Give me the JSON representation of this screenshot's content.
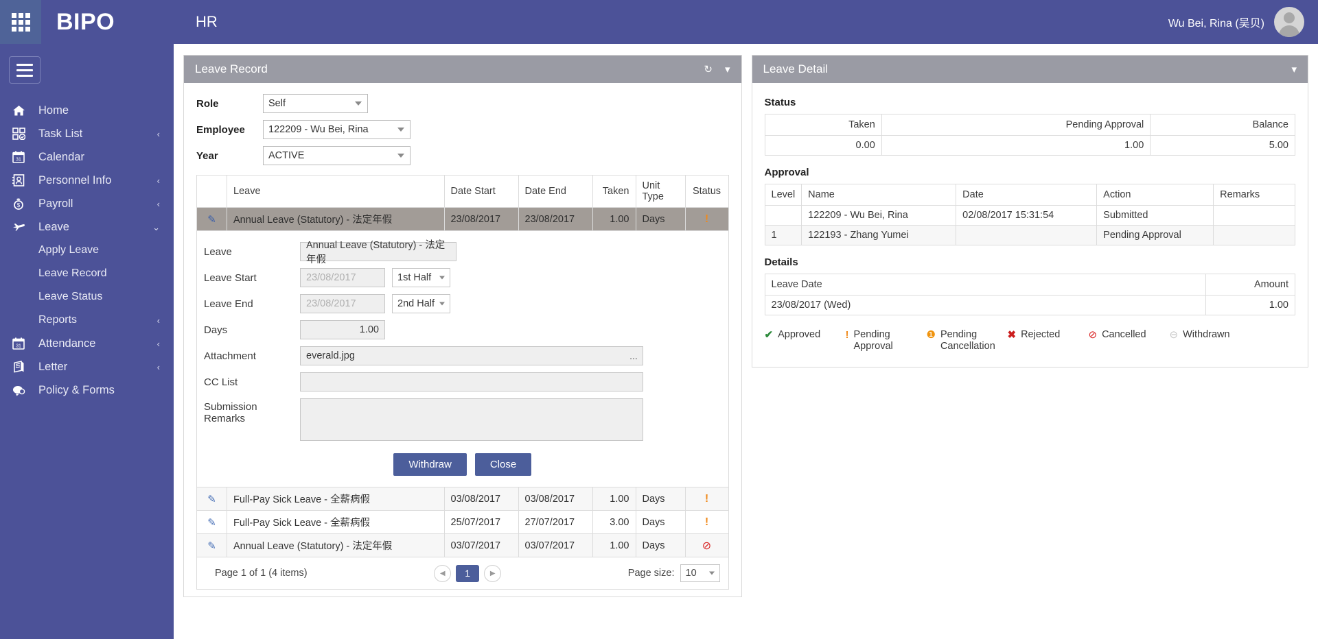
{
  "topbar": {
    "brand": "BIPO",
    "module": "HR",
    "user_name": "Wu Bei, Rina (吴贝)",
    "launcher_icon": "grid-apps-icon",
    "avatar_icon": "user-avatar-icon"
  },
  "sidebar": {
    "toggle_icon": "hamburger-icon",
    "items": [
      {
        "label": "Home",
        "icon": "home-icon",
        "caret": ""
      },
      {
        "label": "Task List",
        "icon": "task-list-icon",
        "caret": "‹"
      },
      {
        "label": "Calendar",
        "icon": "calendar-icon",
        "caret": ""
      },
      {
        "label": "Personnel Info",
        "icon": "personnel-icon",
        "caret": "‹"
      },
      {
        "label": "Payroll",
        "icon": "payroll-icon",
        "caret": "‹"
      },
      {
        "label": "Leave",
        "icon": "leave-plane-icon",
        "caret": "⌄"
      }
    ],
    "leave_subitems": [
      {
        "label": "Apply Leave",
        "caret": ""
      },
      {
        "label": "Leave Record",
        "caret": ""
      },
      {
        "label": "Leave Status",
        "caret": ""
      },
      {
        "label": "Reports",
        "caret": "‹"
      }
    ],
    "items_after": [
      {
        "label": "Attendance",
        "icon": "attendance-icon",
        "caret": "‹"
      },
      {
        "label": "Letter",
        "icon": "letter-icon",
        "caret": "‹"
      },
      {
        "label": "Policy & Forms",
        "icon": "policy-forms-icon",
        "caret": ""
      }
    ]
  },
  "leave_record": {
    "title": "Leave Record",
    "refresh_icon": "refresh-icon",
    "collapse_icon": "chevron-down-icon",
    "filters": {
      "role_label": "Role",
      "role_value": "Self",
      "employee_label": "Employee",
      "employee_value": "122209 - Wu Bei, Rina",
      "year_label": "Year",
      "year_value": "ACTIVE"
    },
    "columns": [
      "",
      "Leave",
      "Date Start",
      "Date End",
      "Taken",
      "Unit Type",
      "Status"
    ],
    "rows": [
      {
        "edit_icon": "pencil-icon",
        "leave": "Annual Leave (Statutory) - 法定年假",
        "date_start": "23/08/2017",
        "date_end": "23/08/2017",
        "taken": "1.00",
        "unit": "Days",
        "status_icon": "pending-approval-icon",
        "status_glyph": "!",
        "selected": true
      },
      {
        "edit_icon": "pencil-icon",
        "leave": "Full-Pay Sick Leave - 全薪病假",
        "date_start": "03/08/2017",
        "date_end": "03/08/2017",
        "taken": "1.00",
        "unit": "Days",
        "status_icon": "pending-approval-icon",
        "status_glyph": "!",
        "selected": false
      },
      {
        "edit_icon": "pencil-icon",
        "leave": "Full-Pay Sick Leave - 全薪病假",
        "date_start": "25/07/2017",
        "date_end": "27/07/2017",
        "taken": "3.00",
        "unit": "Days",
        "status_icon": "pending-approval-icon",
        "status_glyph": "!",
        "selected": false
      },
      {
        "edit_icon": "pencil-icon",
        "leave": "Annual Leave (Statutory) - 法定年假",
        "date_start": "03/07/2017",
        "date_end": "03/07/2017",
        "taken": "1.00",
        "unit": "Days",
        "status_icon": "cancelled-icon",
        "status_glyph": "⊘",
        "selected": false
      }
    ],
    "detail_form": {
      "leave_label": "Leave",
      "leave_value": "Annual Leave (Statutory) - 法定年假",
      "leave_start_label": "Leave Start",
      "leave_start_value": "23/08/2017",
      "leave_start_half": "1st Half",
      "leave_end_label": "Leave End",
      "leave_end_value": "23/08/2017",
      "leave_end_half": "2nd Half",
      "days_label": "Days",
      "days_value": "1.00",
      "attachment_label": "Attachment",
      "attachment_value": "everald.jpg",
      "browse_label": "...",
      "cc_list_label": "CC List",
      "cc_list_value": "",
      "remarks_label": "Submission Remarks",
      "remarks_value": "",
      "withdraw_button": "Withdraw",
      "close_button": "Close"
    },
    "pager": {
      "info": "Page 1 of 1 (4 items)",
      "prev_icon": "chevron-left-icon",
      "next_icon": "chevron-right-icon",
      "current_page": "1",
      "page_size_label": "Page size:",
      "page_size_value": "10"
    }
  },
  "leave_detail": {
    "title": "Leave Detail",
    "collapse_icon": "chevron-down-icon",
    "status_section_title": "Status",
    "status_columns": [
      "Taken",
      "Pending Approval",
      "Balance"
    ],
    "status_values": [
      "0.00",
      "1.00",
      "5.00"
    ],
    "approval_section_title": "Approval",
    "approval_columns": [
      "Level",
      "Name",
      "Date",
      "Action",
      "Remarks"
    ],
    "approval_rows": [
      {
        "level": "",
        "name": "122209 - Wu Bei, Rina",
        "date": "02/08/2017 15:31:54",
        "action": "Submitted",
        "remarks": ""
      },
      {
        "level": "1",
        "name": "122193 - Zhang Yumei",
        "date": "",
        "action": "Pending Approval",
        "remarks": ""
      }
    ],
    "details_section_title": "Details",
    "details_columns": [
      "Leave Date",
      "Amount"
    ],
    "details_rows": [
      {
        "leave_date": "23/08/2017 (Wed)",
        "amount": "1.00"
      }
    ],
    "legend": [
      {
        "glyph": "✔",
        "label": "Approved",
        "icon": "approved-icon",
        "class": "g-approved"
      },
      {
        "glyph": "!",
        "label": "Pending Approval",
        "icon": "pending-approval-icon",
        "class": "g-pending"
      },
      {
        "glyph": "❶",
        "label": "Pending Cancellation",
        "icon": "pending-cancellation-icon",
        "class": "g-pcancel"
      },
      {
        "glyph": "✖",
        "label": "Rejected",
        "icon": "rejected-icon",
        "class": "g-rejected"
      },
      {
        "glyph": "⊘",
        "label": "Cancelled",
        "icon": "cancelled-icon",
        "class": "g-cancel"
      },
      {
        "glyph": "⊖",
        "label": "Withdrawn",
        "icon": "withdrawn-icon",
        "class": "g-withdraw"
      }
    ]
  },
  "colors": {
    "brand_purple": "#4c5298",
    "panel_header_gray": "#9a9ba4",
    "button_blue": "#4c5e9b",
    "selected_row": "#a29c97",
    "pending_orange": "#f08a1c",
    "cancel_red": "#d81f1f",
    "approved_green": "#2e8b3d"
  }
}
